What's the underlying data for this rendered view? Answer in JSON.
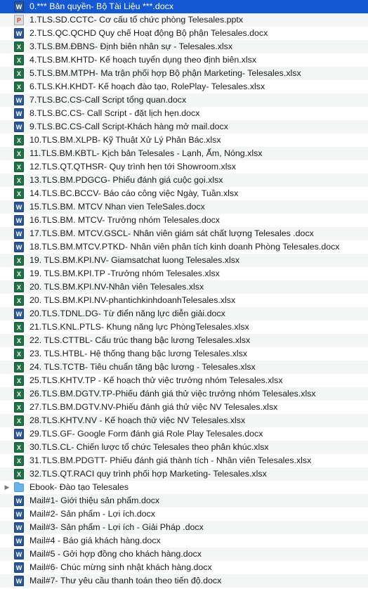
{
  "rows": [
    {
      "name": "0.*** Bản quyền- Bộ Tài Liệu ***.docx",
      "kind": "docx",
      "icon": "word-doc-icon",
      "icon_glyph": "W",
      "selected": true
    },
    {
      "name": "1.TLS.SD.CCTC- Cơ cấu tổ chức phòng Telesales.pptx",
      "kind": "pptx",
      "icon": "powerpoint-icon",
      "icon_glyph": "P"
    },
    {
      "name": "2.TLS.QC.QCHD Quy chế Hoạt động Bộ phận Telesales.docx",
      "kind": "docx",
      "icon": "word-doc-icon",
      "icon_glyph": "W"
    },
    {
      "name": "3.TLS.BM.ĐBNS- Định biên nhân sự - Telesales.xlsx",
      "kind": "xlsx",
      "icon": "excel-sheet-icon",
      "icon_glyph": "X"
    },
    {
      "name": "4.TLS.BM.KHTD- Kế hoạch tuyển dụng theo định biên.xlsx",
      "kind": "xlsx",
      "icon": "excel-sheet-icon",
      "icon_glyph": "X"
    },
    {
      "name": "5.TLS.BM.MTPH- Ma trận phối hợp Bộ phận Marketing- Telesales.xlsx",
      "kind": "xlsx",
      "icon": "excel-sheet-icon",
      "icon_glyph": "X"
    },
    {
      "name": "6.TLS.KH.KHDT- Kế hoạch đào tạo, RolePlay- Telesales.xlsx",
      "kind": "xlsx",
      "icon": "excel-sheet-icon",
      "icon_glyph": "X"
    },
    {
      "name": "7.TLS.BC.CS-Call Script tổng quan.docx",
      "kind": "docx",
      "icon": "word-doc-icon",
      "icon_glyph": "W"
    },
    {
      "name": "8.TLS.BC.CS- Call Script - đặt lịch hẹn.docx",
      "kind": "docx",
      "icon": "word-doc-icon",
      "icon_glyph": "W"
    },
    {
      "name": "9.TLS.BC.CS-Call Script-Khách hàng mở mail.docx",
      "kind": "docx",
      "icon": "word-doc-icon",
      "icon_glyph": "W"
    },
    {
      "name": "10.TLS.BM.XLPB- Kỹ Thuật Xử Lý Phản Bác.xlsx",
      "kind": "xlsx",
      "icon": "excel-sheet-icon",
      "icon_glyph": "X"
    },
    {
      "name": "11.TLS.BM.KBTL- Kịch bản Telesales - Lạnh, Ấm, Nóng.xlsx",
      "kind": "xlsx",
      "icon": "excel-sheet-icon",
      "icon_glyph": "X"
    },
    {
      "name": "12.TLS.QT.QTHSR- Quy trình hẹn tới Showroom.xlsx",
      "kind": "xlsx",
      "icon": "excel-sheet-icon",
      "icon_glyph": "X"
    },
    {
      "name": "13.TLS.BM.PDGCG- Phiếu đánh giá cuộc gọi.xlsx",
      "kind": "xlsx",
      "icon": "excel-sheet-icon",
      "icon_glyph": "X"
    },
    {
      "name": "14.TLS.BC.BCCV- Báo cáo công việc Ngày, Tuần.xlsx",
      "kind": "xlsx",
      "icon": "excel-sheet-icon",
      "icon_glyph": "X"
    },
    {
      "name": "15.TLS.BM. MTCV Nhan vien TeleSales.docx",
      "kind": "docx",
      "icon": "word-doc-icon",
      "icon_glyph": "W"
    },
    {
      "name": "16.TLS.BM. MTCV- Trưởng nhóm Telesales.docx",
      "kind": "docx",
      "icon": "word-doc-icon",
      "icon_glyph": "W"
    },
    {
      "name": "17.TLS.BM. MTCV.GSCL- Nhân viên giám sát chất lượng Telesales .docx",
      "kind": "docx",
      "icon": "word-doc-icon",
      "icon_glyph": "W"
    },
    {
      "name": "18.TLS.BM.MTCV.PTKD- Nhân viên phân tích kinh doanh Phòng Telesales.docx",
      "kind": "docx",
      "icon": "word-doc-icon",
      "icon_glyph": "W"
    },
    {
      "name": "19. TLS.BM.KPI.NV- Giamsatchat luong Telesales.xlsx",
      "kind": "xlsx",
      "icon": "excel-sheet-icon",
      "icon_glyph": "X"
    },
    {
      "name": "19. TLS.BM.KPI.TP -Trưởng nhóm Telesales.xlsx",
      "kind": "xlsx",
      "icon": "excel-sheet-icon",
      "icon_glyph": "X"
    },
    {
      "name": "20. TLS.BM.KPI.NV-Nhân viên Telesales.xlsx",
      "kind": "xlsx",
      "icon": "excel-sheet-icon",
      "icon_glyph": "X"
    },
    {
      "name": "20. TLS.BM.KPI.NV-phantichkinhdoanhTelesales.xlsx",
      "kind": "xlsx",
      "icon": "excel-sheet-icon",
      "icon_glyph": "X"
    },
    {
      "name": "20.TLS.TDNL.DG- Từ điển năng lực diễn giải.docx",
      "kind": "docx",
      "icon": "word-doc-icon",
      "icon_glyph": "W"
    },
    {
      "name": "21.TLS.KNL.PTLS- Khung năng lực PhòngTelesales.xlsx",
      "kind": "xlsx",
      "icon": "excel-sheet-icon",
      "icon_glyph": "X"
    },
    {
      "name": "22. TLS.CTTBL- Cấu trúc thang bậc lương Telesales.xlsx",
      "kind": "xlsx",
      "icon": "excel-sheet-icon",
      "icon_glyph": "X"
    },
    {
      "name": "23. TLS.HTBL- Hệ thống thang bậc lương Telesales.xlsx",
      "kind": "xlsx",
      "icon": "excel-sheet-icon",
      "icon_glyph": "X"
    },
    {
      "name": "24. TLS.TCTB- Tiêu chuẩn tăng bậc lương - Telesales.xlsx",
      "kind": "xlsx",
      "icon": "excel-sheet-icon",
      "icon_glyph": "X"
    },
    {
      "name": "25.TLS.KHTV.TP - Kế hoạch thử việc trưởng nhóm Telesales.xlsx",
      "kind": "xlsx",
      "icon": "excel-sheet-icon",
      "icon_glyph": "X"
    },
    {
      "name": "26.TLS.BM.DGTV.TP-Phiếu đánh giá thử việc trưởng nhóm Telesales.xlsx",
      "kind": "xlsx",
      "icon": "excel-sheet-icon",
      "icon_glyph": "X"
    },
    {
      "name": "27.TLS.BM.DGTV.NV-Phiếu đánh giá thử việc NV Telesales.xlsx",
      "kind": "xlsx",
      "icon": "excel-sheet-icon",
      "icon_glyph": "X"
    },
    {
      "name": "28.TLS.KHTV.NV - Kế hoạch thử việc NV Telesales.xlsx",
      "kind": "xlsx",
      "icon": "excel-sheet-icon",
      "icon_glyph": "X"
    },
    {
      "name": "29.TLS.GF- Google Form đánh giá Role Play Telesales.docx",
      "kind": "docx",
      "icon": "word-doc-icon",
      "icon_glyph": "W"
    },
    {
      "name": "30.TLS.CL- Chiến lược tổ chức Telesales theo phân khúc.xlsx",
      "kind": "xlsx",
      "icon": "excel-sheet-icon",
      "icon_glyph": "X"
    },
    {
      "name": "31.TLS.BM.PDGTT- Phiếu đánh giá thành tích - Nhân viên Telesales.xlsx",
      "kind": "xlsx",
      "icon": "excel-sheet-icon",
      "icon_glyph": "X"
    },
    {
      "name": "32.TLS.QT.RACI quy trình phối hợp Marketing- Telesales.xlsx",
      "kind": "xlsx",
      "icon": "excel-sheet-icon",
      "icon_glyph": "X"
    },
    {
      "name": "Ebook- Đào tạo Telesales",
      "kind": "folder",
      "icon": "folder-icon",
      "icon_glyph": "",
      "disclosure": "▶"
    },
    {
      "name": "Mail#1- Giới thiệu sản phẩm.docx",
      "kind": "docx",
      "icon": "word-doc-icon",
      "icon_glyph": "W"
    },
    {
      "name": "Mail#2- Sản phẩm - Lợi ích.docx",
      "kind": "docx",
      "icon": "word-doc-icon",
      "icon_glyph": "W"
    },
    {
      "name": "Mail#3- Sản phẩm - Lợi ích - Giải Pháp .docx",
      "kind": "docx",
      "icon": "word-doc-icon",
      "icon_glyph": "W"
    },
    {
      "name": "Mail#4 - Báo giá khách hàng.docx",
      "kind": "docx",
      "icon": "word-doc-icon",
      "icon_glyph": "W"
    },
    {
      "name": "Mail#5 - Gởi hợp đồng cho khách hàng.docx",
      "kind": "docx",
      "icon": "word-doc-icon",
      "icon_glyph": "W"
    },
    {
      "name": "Mail#6- Chúc mừng sinh nhật khách hàng.docx",
      "kind": "docx",
      "icon": "word-doc-icon",
      "icon_glyph": "W"
    },
    {
      "name": "Mail#7- Thư yêu cầu thanh toán theo tiến độ.docx",
      "kind": "docx",
      "icon": "word-doc-icon",
      "icon_glyph": "W"
    }
  ],
  "colors": {
    "selection": "#1458d3",
    "alt_row": "#f4f5f5",
    "word": "#2b5797",
    "excel": "#1f7244",
    "folder": "#6bb4ea"
  }
}
